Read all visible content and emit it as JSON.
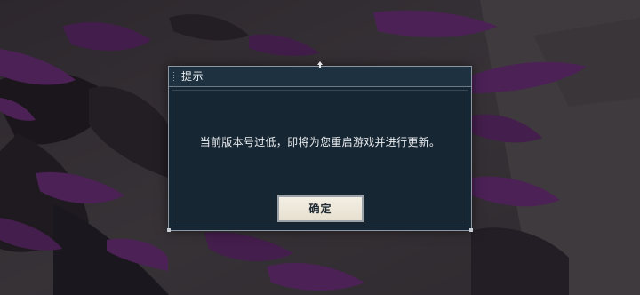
{
  "dialog": {
    "title": "提示",
    "message": "当前版本号过低，即将为您重启游戏并进行更新。",
    "confirm_label": "确定"
  },
  "colors": {
    "dialog_bg": "#172633",
    "title_bar_bg": "#1e3140",
    "border": "#8c97a3",
    "button_bg": "#f1ebdf",
    "text": "#e9ecef"
  },
  "icons": [
    "drag-grip-icon",
    "pin-icon"
  ]
}
